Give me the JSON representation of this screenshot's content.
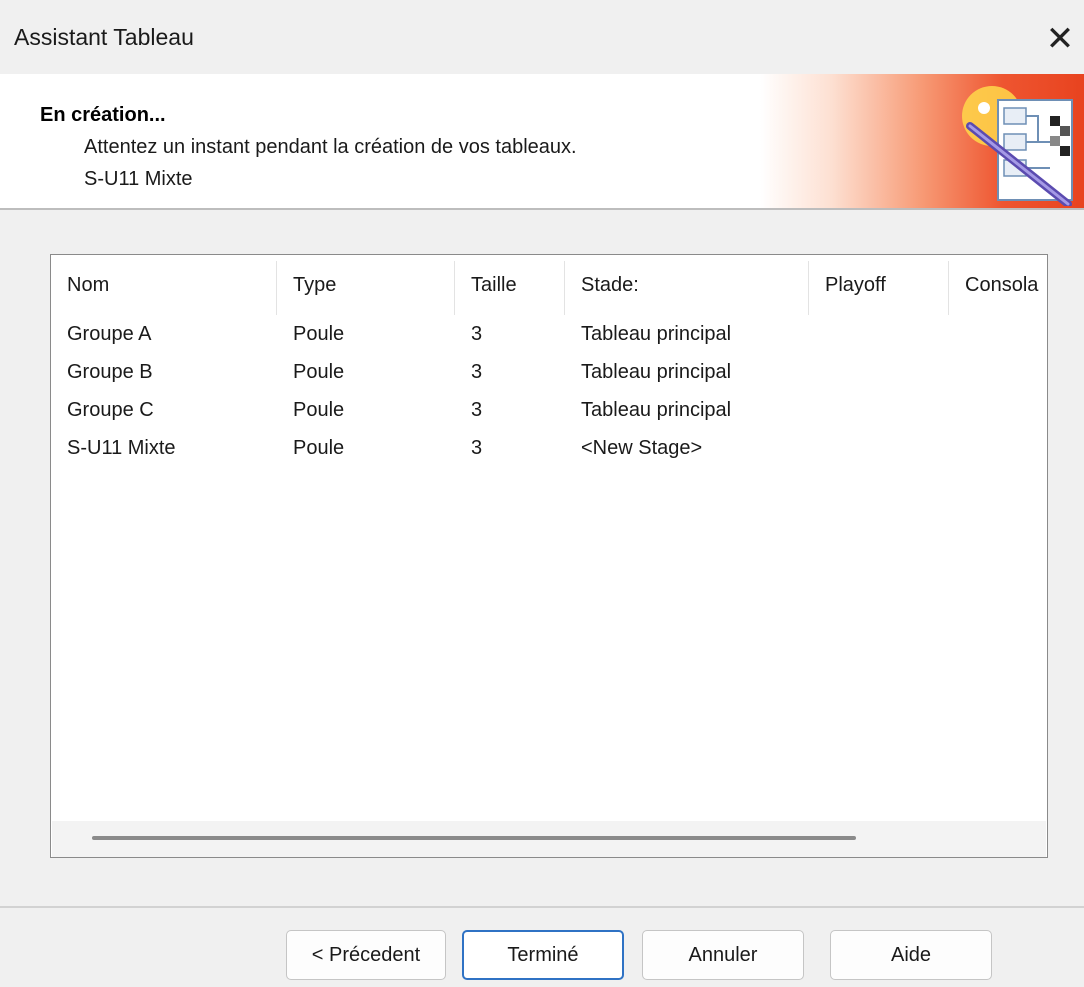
{
  "window": {
    "title": "Assistant Tableau",
    "close_glyph": "✕"
  },
  "header": {
    "heading": "En création...",
    "description": "Attentez un instant pendant la création de vos tableaux.",
    "subtitle": "S-U11 Mixte",
    "icon": "wizard-draw-icon"
  },
  "list": {
    "columns": [
      "Nom",
      "Type",
      "Taille",
      "Stade:",
      "Playoff",
      "Consola"
    ],
    "rows": [
      [
        "Groupe A",
        "Poule",
        "3",
        "Tableau principal",
        "",
        ""
      ],
      [
        "Groupe B",
        "Poule",
        "3",
        "Tableau principal",
        "",
        ""
      ],
      [
        "Groupe C",
        "Poule",
        "3",
        "Tableau principal",
        "",
        ""
      ],
      [
        "S-U11 Mixte",
        "Poule",
        "3",
        "<New Stage>",
        "",
        ""
      ]
    ]
  },
  "buttons": {
    "previous": "< Précedent",
    "finish": "Terminé",
    "cancel": "Annuler",
    "help": "Aide"
  }
}
